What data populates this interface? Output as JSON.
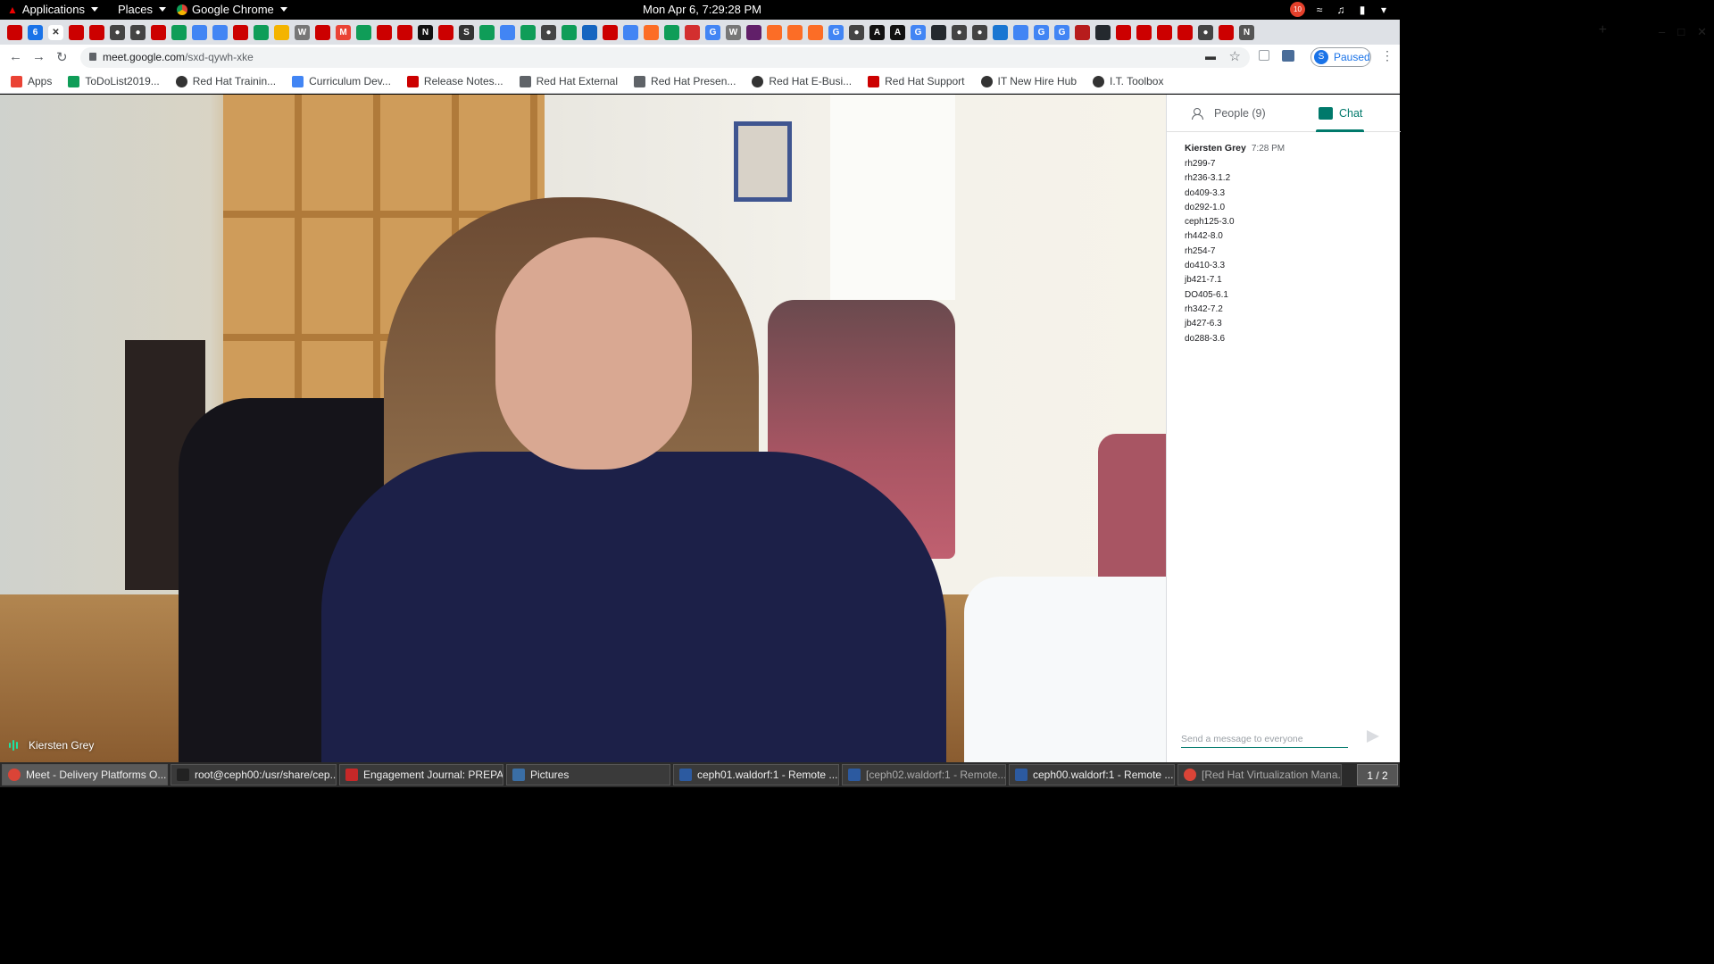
{
  "topbar": {
    "applications": "Applications",
    "places": "Places",
    "app": "Google Chrome",
    "clock": "Mon Apr  6,  7:29:28 PM",
    "notifications": "10"
  },
  "browser": {
    "url_host": "meet.google.com",
    "url_path": "/sxd-qywh-xke",
    "profile_initial": "S",
    "profile_status": "Paused",
    "tab_favicons": [
      "redhat",
      "calendar",
      "close",
      "redhat",
      "redhat",
      "globe",
      "globe",
      "redhat",
      "drive",
      "docs",
      "docs",
      "redhat",
      "sheets",
      "keep",
      "wiki",
      "redhat",
      "gmail",
      "sheets",
      "redhat",
      "redhat",
      "notion",
      "redhat",
      "s",
      "sheets",
      "docs",
      "sheets",
      "globe",
      "sheets",
      "doc",
      "redhat",
      "docs",
      "gitlab",
      "sheets",
      "acrobat",
      "google",
      "wiki",
      "slack",
      "gitlab",
      "gitlab",
      "gitlab",
      "google",
      "globe",
      "a",
      "a",
      "google",
      "github",
      "globe",
      "globe",
      "bluejeans",
      "docs",
      "google",
      "google",
      "bug",
      "github",
      "redhat",
      "redhat",
      "redhat",
      "redhat",
      "globe",
      "redhat",
      "n"
    ]
  },
  "bookmarks": [
    {
      "label": "Apps",
      "icon": "apps-grid"
    },
    {
      "label": "ToDoList2019...",
      "icon": "sheets"
    },
    {
      "label": "Red Hat Trainin...",
      "icon": "globe"
    },
    {
      "label": "Curriculum Dev...",
      "icon": "docs"
    },
    {
      "label": "Release Notes...",
      "icon": "redhat"
    },
    {
      "label": "Red Hat External",
      "icon": "folder"
    },
    {
      "label": "Red Hat Presen...",
      "icon": "folder"
    },
    {
      "label": "Red Hat E-Busi...",
      "icon": "globe"
    },
    {
      "label": "Red Hat Support",
      "icon": "redhat-support"
    },
    {
      "label": "IT New Hire Hub",
      "icon": "globe"
    },
    {
      "label": "I.T. Toolbox",
      "icon": "globe"
    }
  ],
  "meet": {
    "active_speaker": "Kiersten Grey",
    "people_tab": "People (9)",
    "chat_tab": "Chat",
    "chat": {
      "sender": "Kiersten Grey",
      "time": "7:28 PM",
      "lines": [
        "rh299-7",
        "rh236-3.1.2",
        "do409-3.3",
        "do292-1.0",
        "ceph125-3.0",
        "rh442-8.0",
        "rh254-7",
        "do410-3.3",
        "jb421-7.1",
        "DO405-6.1",
        "rh342-7.2",
        "jb427-6.3",
        "do288-3.6"
      ]
    },
    "input_placeholder": "Send a message to everyone"
  },
  "taskbar": [
    {
      "label": "Meet - Delivery Platforms O...",
      "icon": "chrome",
      "active": true
    },
    {
      "label": "root@ceph00:/usr/share/cep...",
      "icon": "terminal",
      "active": false
    },
    {
      "label": "Engagement Journal: PREPA...",
      "icon": "document",
      "active": false
    },
    {
      "label": "Pictures",
      "icon": "files",
      "active": false
    },
    {
      "label": "ceph01.waldorf:1 - Remote ...",
      "icon": "remote",
      "active": false
    },
    {
      "label": "[ceph02.waldorf:1 - Remote...",
      "icon": "remote",
      "active": false
    },
    {
      "label": "ceph00.waldorf:1 - Remote ...",
      "icon": "remote",
      "active": false
    },
    {
      "label": "[Red Hat Virtualization Mana...",
      "icon": "chrome",
      "active": false
    }
  ],
  "workspace": "1 / 2",
  "colors": {
    "meet_green": "#00796b",
    "redhat_red": "#cc0000",
    "chrome_blue": "#1a73e8"
  }
}
